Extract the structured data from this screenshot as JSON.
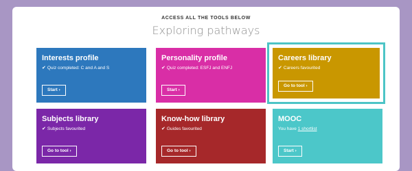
{
  "header": {
    "eyebrow": "ACCESS ALL THE TOOLS BELOW",
    "title": "Exploring pathways"
  },
  "cards": [
    {
      "title": "Interests profile",
      "status": "Quiz completed: C and A and S",
      "check": "✔",
      "button": "Start",
      "button_arrow": "›",
      "color": "#2d78bd"
    },
    {
      "title": "Personality profile",
      "status": "Quiz completed: ESFJ and ENFJ",
      "check": "✔",
      "button": "Start",
      "button_arrow": "›",
      "color": "#d92ea6"
    },
    {
      "title": "Careers library",
      "status": "Careers favourited",
      "check": "✔",
      "button": "Go to tool",
      "button_arrow": "›",
      "color": "#c99700",
      "highlight_color": "#4cc4c6"
    },
    {
      "title": "Subjects library",
      "status": "Subjects favourited",
      "check": "✔",
      "button": "Go to tool",
      "button_arrow": "›",
      "color": "#7b27a8"
    },
    {
      "title": "Know-how library",
      "status": "Guides favourited",
      "check": "✔",
      "button": "Go to tool",
      "button_arrow": "›",
      "color": "#a6282a"
    },
    {
      "title": "MOOC",
      "status_prefix": "You have ",
      "status_link": "1 shortlist",
      "button": "Start",
      "button_arrow": "›",
      "color": "#4cc7c9"
    }
  ],
  "colors": {
    "page_background": "#a896c4",
    "frame_background": "#ffffff",
    "heading_text": "#8e8e8e"
  }
}
